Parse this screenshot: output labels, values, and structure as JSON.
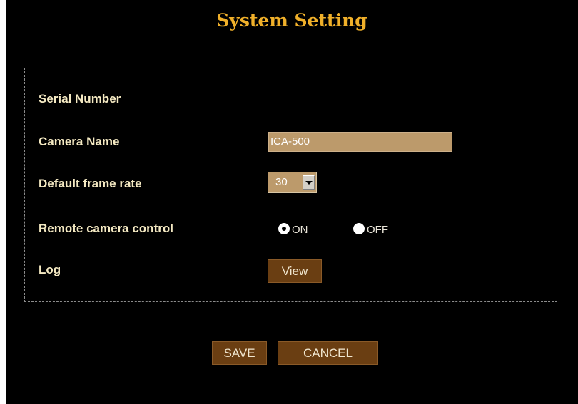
{
  "page": {
    "title": "System Setting"
  },
  "fields": {
    "serial_number_label": "Serial Number",
    "camera_name_label": "Camera Name",
    "camera_name_value": "ICA-500",
    "frame_rate_label": "Default frame rate",
    "frame_rate_value": "30",
    "remote_control_label": "Remote camera control",
    "remote_on_label": "ON",
    "remote_off_label": "OFF",
    "remote_selected": "ON",
    "log_label": "Log",
    "log_button": "View"
  },
  "actions": {
    "save": "SAVE",
    "cancel": "CANCEL"
  },
  "colors": {
    "background": "#000000",
    "title": "#f0b02a",
    "input_bg": "#bc9a6b",
    "button_bg": "#6a3e12"
  }
}
